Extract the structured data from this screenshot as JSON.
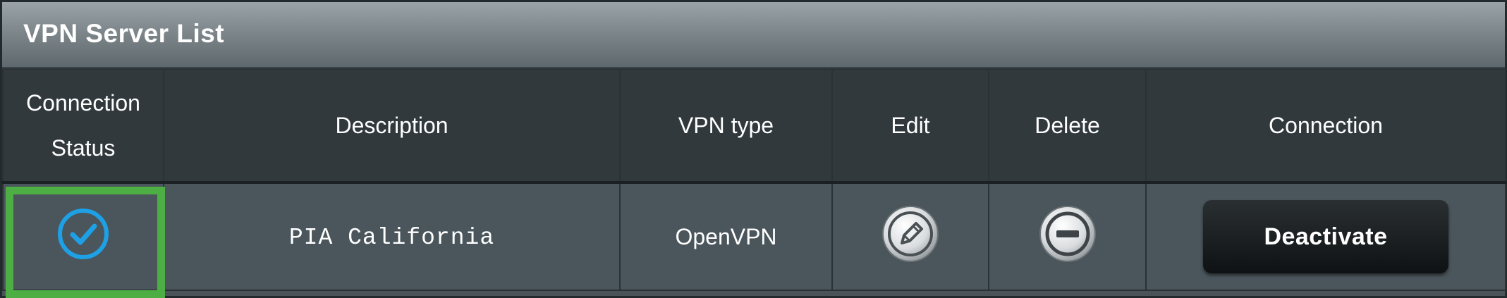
{
  "panel": {
    "title": "VPN Server List"
  },
  "table": {
    "headers": {
      "connection_status_line1": "Connection",
      "connection_status_line2": "Status",
      "description": "Description",
      "vpn_type": "VPN type",
      "edit": "Edit",
      "delete": "Delete",
      "connection": "Connection"
    },
    "rows": [
      {
        "status_icon": "check-circle-icon",
        "description": "PIA California",
        "vpn_type": "OpenVPN",
        "edit_icon": "pencil-icon",
        "delete_icon": "minus-circle-icon",
        "connection_button": "Deactivate"
      }
    ]
  },
  "colors": {
    "status_check": "#1ea0e6",
    "highlight_frame": "#4cae43",
    "header_bg": "#31393d",
    "row_bg": "#4a565c",
    "button_bg": "#121719"
  }
}
